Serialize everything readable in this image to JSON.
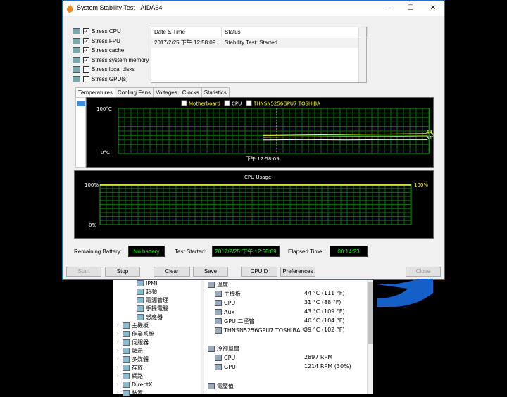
{
  "window": {
    "title": "System Stability Test - AIDA64",
    "controls": {
      "minimize": "—",
      "maximize": "☐",
      "close": "✕"
    }
  },
  "stress_options": [
    {
      "label": "Stress CPU",
      "checked": true
    },
    {
      "label": "Stress FPU",
      "checked": true
    },
    {
      "label": "Stress cache",
      "checked": true
    },
    {
      "label": "Stress system memory",
      "checked": true
    },
    {
      "label": "Stress local disks",
      "checked": false
    },
    {
      "label": "Stress GPU(s)",
      "checked": false
    }
  ],
  "log": {
    "col_date": "Date & Time",
    "col_status": "Status",
    "rows": [
      {
        "date": "2017/2/25 下午 12:58:09",
        "status": "Stability Test: Started"
      }
    ]
  },
  "tabs": [
    "Temperatures",
    "Cooling Fans",
    "Voltages",
    "Clocks",
    "Statistics"
  ],
  "temp_chart": {
    "legend": [
      {
        "label": "Motherboard",
        "color": "#ffff40"
      },
      {
        "label": "CPU",
        "color": "#ffffff"
      },
      {
        "label": "THNSN5256GPU7 TOSHIBA",
        "color": "#ffff40"
      }
    ],
    "y_top": "100°C",
    "y_bottom": "0°C",
    "time_label": "下午 12:58:09",
    "end_values": {
      "a": "44",
      "b": "39",
      "c": "31"
    }
  },
  "chart_data": [
    {
      "type": "line",
      "title": "",
      "ylabel": "",
      "ylim": [
        0,
        100
      ],
      "series": [
        {
          "name": "Motherboard",
          "values": [
            40,
            41,
            42,
            43,
            44
          ]
        },
        {
          "name": "CPU",
          "values": [
            30,
            31,
            30,
            31,
            31
          ]
        },
        {
          "name": "THNSN5256GPU7 TOSHIBA",
          "values": [
            36,
            37,
            38,
            38,
            39
          ]
        }
      ]
    },
    {
      "type": "line",
      "title": "CPU Usage",
      "ylim": [
        0,
        100
      ],
      "series": [
        {
          "name": "",
          "values": [
            100,
            100,
            100,
            100,
            100
          ]
        }
      ]
    }
  ],
  "cpu_chart": {
    "title": "CPU Usage",
    "y_top": "100%",
    "y_bottom": "0%",
    "current": "100%"
  },
  "status": {
    "battery_label": "Remaining Battery:",
    "battery_value": "No battery",
    "started_label": "Test Started:",
    "started_value": "2017/2/25 下午 12:58:09",
    "elapsed_label": "Elapsed Time:",
    "elapsed_value": "00:14:23"
  },
  "buttons": {
    "start": "Start",
    "stop": "Stop",
    "clear": "Clear",
    "save": "Save",
    "cpuid": "CPUID",
    "preferences": "Preferences",
    "close": "Close"
  },
  "bg_tree": [
    {
      "label": "IPMI",
      "level": 1
    },
    {
      "label": "超頻",
      "level": 1
    },
    {
      "label": "電源管理",
      "level": 1
    },
    {
      "label": "手提電腦",
      "level": 1
    },
    {
      "label": "感應器",
      "level": 1
    },
    {
      "label": "主機板",
      "level": 0
    },
    {
      "label": "作業系統",
      "level": 0
    },
    {
      "label": "伺服器",
      "level": 0
    },
    {
      "label": "顯示",
      "level": 0
    },
    {
      "label": "多媒體",
      "level": 0
    },
    {
      "label": "存放",
      "level": 0
    },
    {
      "label": "網路",
      "level": 0
    },
    {
      "label": "DirectX",
      "level": 0
    },
    {
      "label": "裝置",
      "level": 0
    }
  ],
  "bg_detail": {
    "temp_header": "溫度",
    "temps": [
      {
        "name": "主機板",
        "value": "44 °C  (111 °F)"
      },
      {
        "name": "CPU",
        "value": "31 °C  (88 °F)"
      },
      {
        "name": "Aux",
        "value": "43 °C  (109 °F)"
      },
      {
        "name": "GPU 二極管",
        "value": "40 °C  (104 °F)"
      },
      {
        "name": "THNSN5256GPU7 TOSHIBA S...",
        "value": "39 °C  (102 °F)"
      }
    ],
    "fan_header": "冷卻風扇",
    "fans": [
      {
        "name": "CPU",
        "value": "2897 RPM"
      },
      {
        "name": "GPU",
        "value": "1214 RPM  (30%)"
      }
    ],
    "volt_header": "電壓值"
  }
}
